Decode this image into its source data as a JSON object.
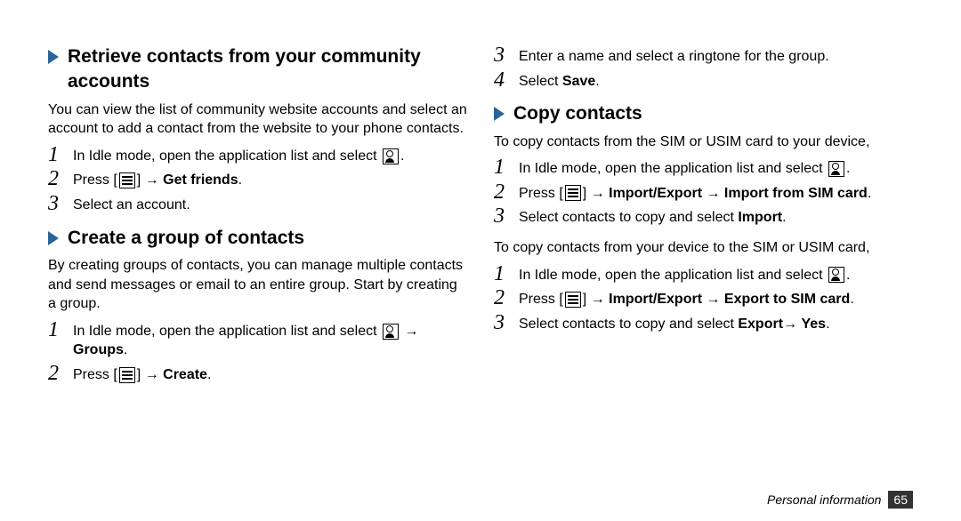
{
  "left": {
    "s1": {
      "title": "Retrieve contacts from your community accounts",
      "intro": "You can view the list of community website accounts and select an account to add a contact from the website to your phone contacts.",
      "step1_a": "In Idle mode, open the application list and select ",
      "step1_b": ".",
      "step2_a": "Press [",
      "step2_b": "] → ",
      "step2_c": "Get friends",
      "step2_d": ".",
      "step3": "Select an account."
    },
    "s2": {
      "title": "Create a group of contacts",
      "intro": "By creating groups of contacts, you can manage multiple contacts and send messages or email to an entire group. Start by creating a group.",
      "step1_a": "In Idle mode, open the application list and select ",
      "step1_b": " → ",
      "step1_c": "Groups",
      "step1_d": ".",
      "step2_a": "Press [",
      "step2_b": "] → ",
      "step2_c": "Create",
      "step2_d": "."
    }
  },
  "right": {
    "cont": {
      "step3": "Enter a name and select a ringtone for the group.",
      "step4_a": "Select ",
      "step4_b": "Save",
      "step4_c": "."
    },
    "s3": {
      "title": "Copy contacts",
      "intro1": "To copy contacts from the SIM or USIM card to your device,",
      "a_step1_a": "In Idle mode, open the application list and select ",
      "a_step1_b": ".",
      "a_step2_a": "Press [",
      "a_step2_b": "] → ",
      "a_step2_c": "Import/Export",
      "a_step2_d": " → ",
      "a_step2_e": "Import from SIM card",
      "a_step2_f": ".",
      "a_step3_a": "Select contacts to copy and select ",
      "a_step3_b": "Import",
      "a_step3_c": ".",
      "intro2": "To copy contacts from your device to the SIM or USIM card,",
      "b_step1_a": "In Idle mode, open the application list and select ",
      "b_step1_b": ".",
      "b_step2_a": "Press [",
      "b_step2_b": "] → ",
      "b_step2_c": "Import/Export",
      "b_step2_d": " → ",
      "b_step2_e": "Export to SIM card",
      "b_step2_f": ".",
      "b_step3_a": "Select contacts to copy and select ",
      "b_step3_b": "Export",
      "b_step3_c": "→ ",
      "b_step3_d": "Yes",
      "b_step3_e": "."
    }
  },
  "footer": {
    "section": "Personal information",
    "page": "65"
  },
  "nums": {
    "n1": "1",
    "n2": "2",
    "n3": "3",
    "n4": "4"
  }
}
